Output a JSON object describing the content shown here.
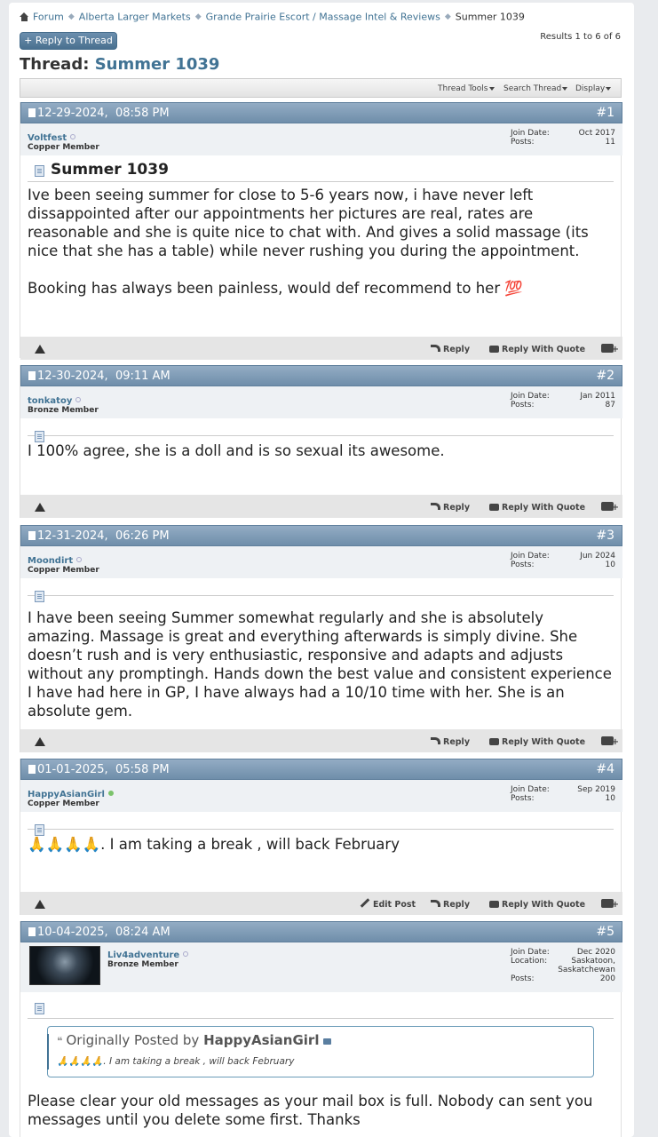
{
  "breadcrumb": {
    "items": [
      "Forum",
      "Alberta Larger Markets",
      "Grande Prairie Escort / Massage Intel & Reviews",
      "Summer 1039"
    ]
  },
  "reply_to_thread": "+ Reply to Thread",
  "results": "Results 1 to 6 of 6",
  "thread": {
    "label": "Thread:",
    "title": "Summer 1039"
  },
  "toolbar": {
    "thread_tools": "Thread Tools",
    "search_thread": "Search Thread",
    "display": "Display"
  },
  "labels": {
    "join_date": "Join Date:",
    "posts": "Posts:",
    "location": "Location:",
    "reply": "Reply",
    "reply_with_quote": "Reply With Quote",
    "edit_post": "Edit Post"
  },
  "colors": {
    "header_blue": "#7d9ab5",
    "link_blue": "#417394",
    "online_green": "#7bc36b"
  },
  "posts": [
    {
      "date": "12-29-2024,",
      "time": "08:58 PM",
      "number": "#1",
      "username": "Voltfest",
      "usertitle": "Copper Member",
      "join_date": "Oct 2017",
      "posts": "11",
      "title": "Summer 1039",
      "body": "Ive been seeing summer for close to 5-6 years now, i have never left dissappointed after our appointments her pictures are real, rates are reasonable and she is quite nice to chat with. And gives a solid massage (its nice that she has a table) while never rushing you during the appointment.",
      "body2": "Booking has always been painless, would def recommend to her 💯"
    },
    {
      "date": "12-30-2024,",
      "time": "09:11 AM",
      "number": "#2",
      "username": "tonkatoy",
      "usertitle": "Bronze Member",
      "join_date": "Jan 2011",
      "posts": "87",
      "body": "I 100% agree, she is a doll and is so sexual its awesome."
    },
    {
      "date": "12-31-2024,",
      "time": "06:26 PM",
      "number": "#3",
      "username": "Moondirt",
      "usertitle": "Copper Member",
      "join_date": "Jun 2024",
      "posts": "10",
      "body": "I have been seeing Summer somewhat regularly and she is absolutely amazing. Massage is great and everything afterwards is simply divine. She doesn’t rush and is very enthusiastic, responsive and adapts and adjusts without any promptingh. Hands down the best value and consistent experience I have had here in GP, I have always had a 10/10 time with her. She is an absolute gem."
    },
    {
      "date": "01-01-2025,",
      "time": "05:58 PM",
      "number": "#4",
      "username": "HappyAsianGirl",
      "usertitle": "Copper Member",
      "join_date": "Sep 2019",
      "posts": "10",
      "body": "🙏🙏🙏🙏. I am taking a break , will back February"
    },
    {
      "date": "10-04-2025,",
      "time": "08:24 AM",
      "number": "#5",
      "username": "Liv4adventure",
      "usertitle": "Bronze Member",
      "join_date": "Dec 2020",
      "location": "Saskatoon, Saskatchewan",
      "posts": "200",
      "quote_prefix": "Originally Posted by",
      "quote_author": "HappyAsianGirl",
      "quote_text": "🙏🙏🙏🙏. I am taking a break , will back February",
      "body": "Please clear your old messages as your mail box is full. Nobody can sent you messages until you delete some first. Thanks"
    }
  ]
}
